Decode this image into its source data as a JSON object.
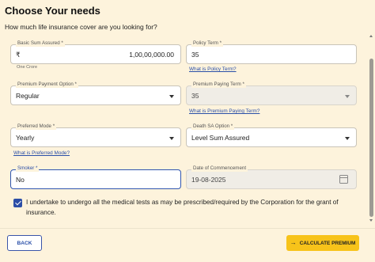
{
  "header": {
    "title": "Choose Your needs",
    "subtitle": "How much life insurance cover are you looking for?"
  },
  "fields": {
    "basic_sum_assured": {
      "label": "Basic Sum Assured *",
      "prefix": "₹",
      "value": "1,00,00,000.00",
      "helper": "One Crore"
    },
    "policy_term": {
      "label": "Policy Term *",
      "value": "35",
      "link": "What is Policy Term?"
    },
    "premium_payment_option": {
      "label": "Premium Payment Option *",
      "value": "Regular"
    },
    "premium_paying_term": {
      "label": "Premium Paying Term *",
      "value": "35",
      "link": "What is Premium Paying Term?"
    },
    "preferred_mode": {
      "label": "Preferred Mode *",
      "value": "Yearly",
      "link": "What is Preferred Mode?"
    },
    "death_sa_option": {
      "label": "Death SA Option *",
      "value": "Level Sum Assured"
    },
    "smoker": {
      "label": "Smoker *",
      "value": "No"
    },
    "date_of_commencement": {
      "label": "Date of Commencement",
      "value": "19-08-2025"
    }
  },
  "consent": {
    "checked": true,
    "text": "I undertake to undergo all the medical tests as may be prescribed/required by the Corporation for the grant of insurance."
  },
  "footer": {
    "back_label": "BACK",
    "calculate_label": "CALCULATE PREMIUM"
  },
  "colors": {
    "background": "#fdf3dc",
    "primary": "#2c4ea6",
    "accent": "#f7c31a"
  },
  "icons": {
    "rupee": "rupee-icon",
    "calendar": "calendar-icon",
    "dropdown": "chevron-down-icon",
    "arrow": "arrow-right-icon",
    "check": "checkbox-check-icon"
  }
}
